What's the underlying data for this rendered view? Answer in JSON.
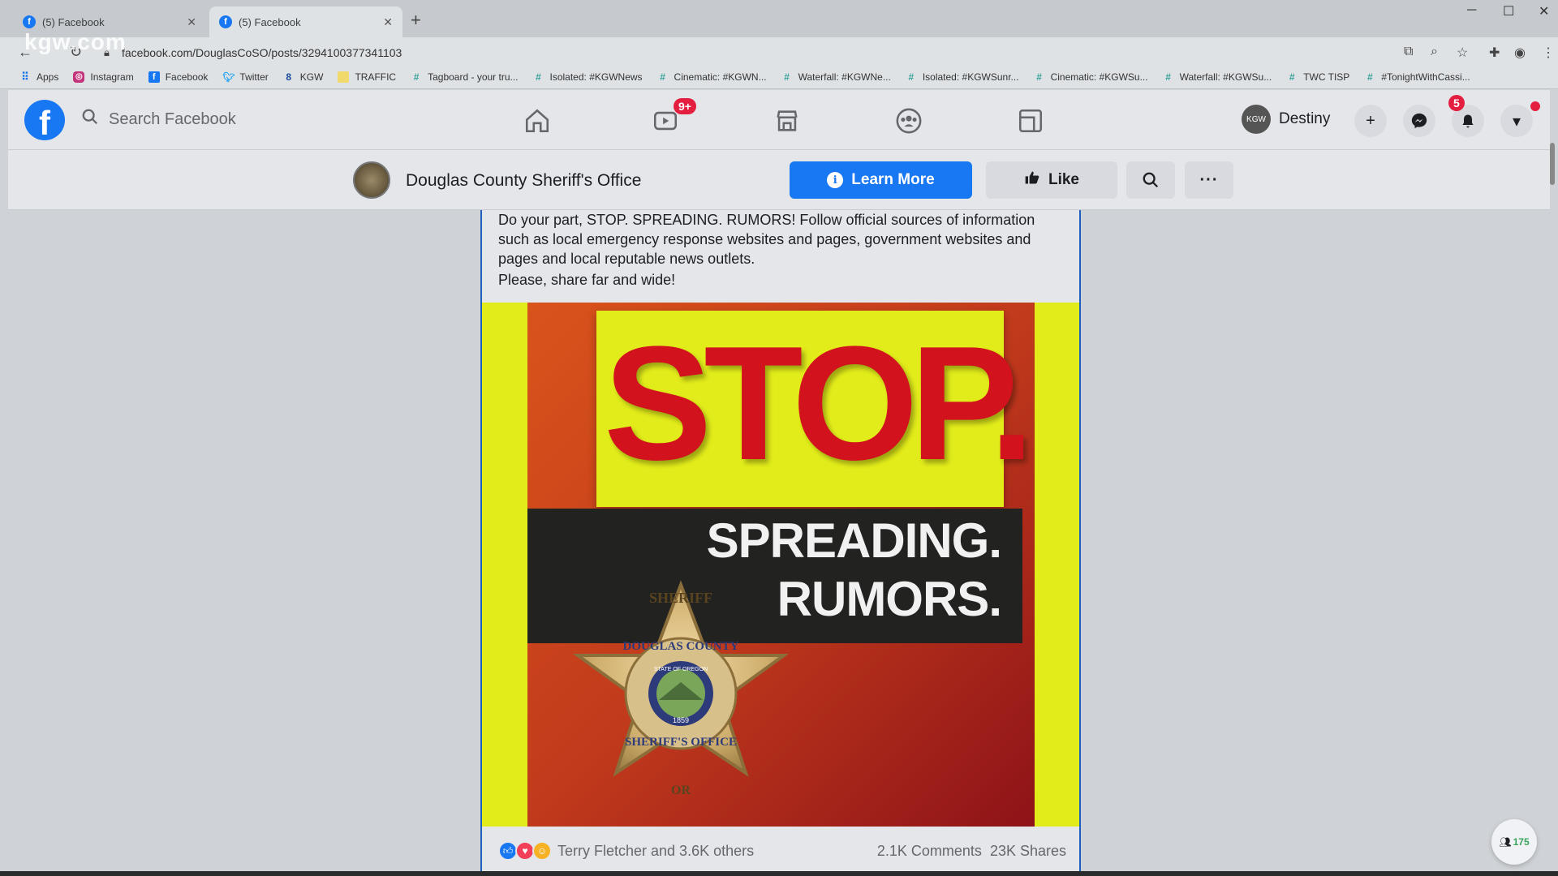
{
  "watermark": "kgw.com",
  "browser": {
    "tabs": [
      {
        "title": "(5) Facebook",
        "active": false
      },
      {
        "title": "(5) Facebook",
        "active": true
      }
    ],
    "url": "facebook.com/DouglasCoSO/posts/3294100377341103",
    "bookmarks": [
      {
        "icon": "apps-icon",
        "label": "Apps"
      },
      {
        "icon": "instagram-icon",
        "label": "Instagram"
      },
      {
        "icon": "facebook-icon",
        "label": "Facebook"
      },
      {
        "icon": "twitter-icon",
        "label": "Twitter"
      },
      {
        "icon": "kgw-icon",
        "label": "KGW"
      },
      {
        "icon": "folder-icon",
        "label": "TRAFFIC"
      },
      {
        "icon": "hashtag-icon",
        "label": "Tagboard - your tru..."
      },
      {
        "icon": "hashtag-icon",
        "label": "Isolated: #KGWNews"
      },
      {
        "icon": "hashtag-icon",
        "label": "Cinematic: #KGWN..."
      },
      {
        "icon": "hashtag-icon",
        "label": "Waterfall: #KGWNe..."
      },
      {
        "icon": "hashtag-icon",
        "label": "Isolated: #KGWSunr..."
      },
      {
        "icon": "hashtag-icon",
        "label": "Cinematic: #KGWSu..."
      },
      {
        "icon": "hashtag-icon",
        "label": "Waterfall: #KGWSu..."
      },
      {
        "icon": "hashtag-icon",
        "label": "TWC TISP"
      },
      {
        "icon": "hashtag-icon",
        "label": "#TonightWithCassi..."
      }
    ]
  },
  "facebook": {
    "search_placeholder": "Search Facebook",
    "watch_badge": "9+",
    "profile_name": "Destiny",
    "notifications_badge": "5",
    "brand_color": "#1877f2"
  },
  "page": {
    "name": "Douglas County Sheriff's Office",
    "learn_more": "Learn More",
    "like": "Like"
  },
  "post": {
    "text": "Do your part, STOP. SPREADING. RUMORS! Follow official sources of information such as local emergency response websites and pages, government websites and pages and local reputable news outlets.",
    "text2": "Please, share far and wide!",
    "image": {
      "headline": "STOP.",
      "line1": "SPREADING.",
      "line2": "RUMORS.",
      "badge_top": "SHERIFF",
      "badge_ring": "DOUGLAS COUNTY",
      "badge_inner": "STATE OF OREGON",
      "badge_year": "1859",
      "badge_bottom": "SHERIFF'S OFFICE",
      "badge_state": "OR"
    },
    "reactions_text": "Terry Fletcher and 3.6K others",
    "comments": "2.1K Comments",
    "shares": "23K Shares"
  },
  "chat": {
    "count": "175"
  }
}
